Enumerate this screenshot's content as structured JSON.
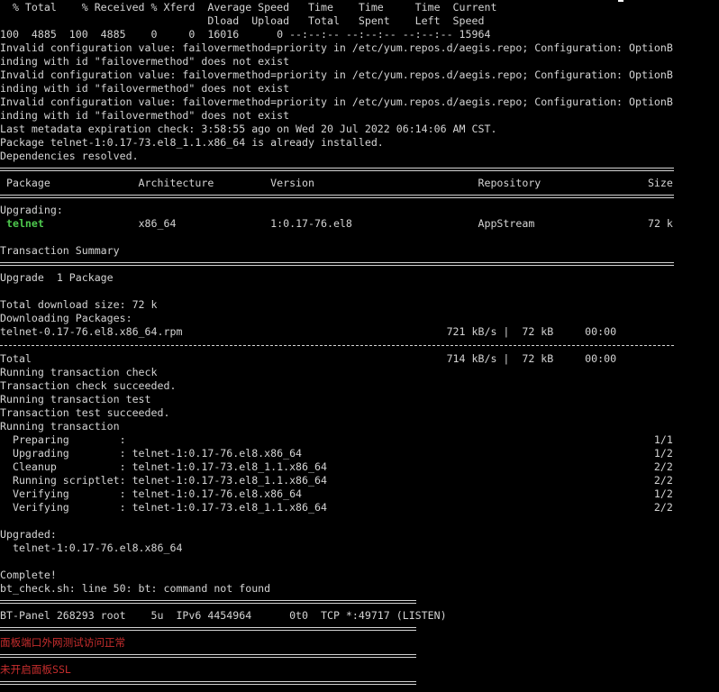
{
  "colors": {
    "background": "#000000",
    "text": "#d4d4d4",
    "package_highlight": "#4ec94e",
    "alert_text": "#c62d2d"
  },
  "curl_header": {
    "line1": "  % Total    % Received % Xferd  Average Speed   Time    Time     Time  Current",
    "line2": "                                 Dload  Upload   Total   Spent    Left  Speed",
    "line3": "100  4885  100  4885    0     0  16016      0 --:--:-- --:--:-- --:--:-- 15964"
  },
  "yum_warnings": [
    "Invalid configuration value: failovermethod=priority in /etc/yum.repos.d/aegis.repo; Configuration: OptionB",
    "inding with id \"failovermethod\" does not exist",
    "Invalid configuration value: failovermethod=priority in /etc/yum.repos.d/aegis.repo; Configuration: OptionB",
    "inding with id \"failovermethod\" does not exist",
    "Invalid configuration value: failovermethod=priority in /etc/yum.repos.d/aegis.repo; Configuration: OptionB",
    "inding with id \"failovermethod\" does not exist"
  ],
  "metadata_check": "Last metadata expiration check: 3:58:55 ago on Wed 20 Jul 2022 06:14:06 AM CST.",
  "already_installed": "Package telnet-1:0.17-73.el8_1.1.x86_64 is already installed.",
  "dependencies_resolved": "Dependencies resolved.",
  "package_table": {
    "header": " Package              Architecture         Version                          Repository                 Size",
    "section_label": "Upgrading:",
    "row_name": " telnet",
    "row_rest": "               x86_64               1:0.17-76.el8                    AppStream                  72 k"
  },
  "transaction_summary": {
    "title": "Transaction Summary",
    "upgrade_count": "Upgrade  1 Package"
  },
  "download": {
    "total_size": "Total download size: 72 k",
    "downloading": "Downloading Packages:",
    "file_line": "telnet-0.17-76.el8.x86_64.rpm                                          721 kB/s |  72 kB     00:00",
    "total_line": "Total                                                                  714 kB/s |  72 kB     00:00"
  },
  "transaction_steps": [
    "Running transaction check",
    "Transaction check succeeded.",
    "Running transaction test",
    "Transaction test succeeded.",
    "Running transaction"
  ],
  "progress_rows": [
    "  Preparing        :                                                                                    1/1",
    "  Upgrading        : telnet-1:0.17-76.el8.x86_64                                                        1/2",
    "  Cleanup          : telnet-1:0.17-73.el8_1.1.x86_64                                                    2/2",
    "  Running scriptlet: telnet-1:0.17-73.el8_1.1.x86_64                                                    2/2",
    "  Verifying        : telnet-1:0.17-76.el8.x86_64                                                        1/2",
    "  Verifying        : telnet-1:0.17-73.el8_1.1.x86_64                                                    2/2"
  ],
  "upgraded": {
    "label": "Upgraded:",
    "package": "  telnet-1:0.17-76.el8.x86_64"
  },
  "complete": "Complete!",
  "bt_error": "bt_check.sh: line 50: bt: command not found",
  "listen_line": "BT-Panel 268293 root    5u  IPv6 4454964      0t0  TCP *:49717 (LISTEN)",
  "panel_status": "面板端口外网测试访问正常",
  "ssl_status": "未开启面板SSL"
}
